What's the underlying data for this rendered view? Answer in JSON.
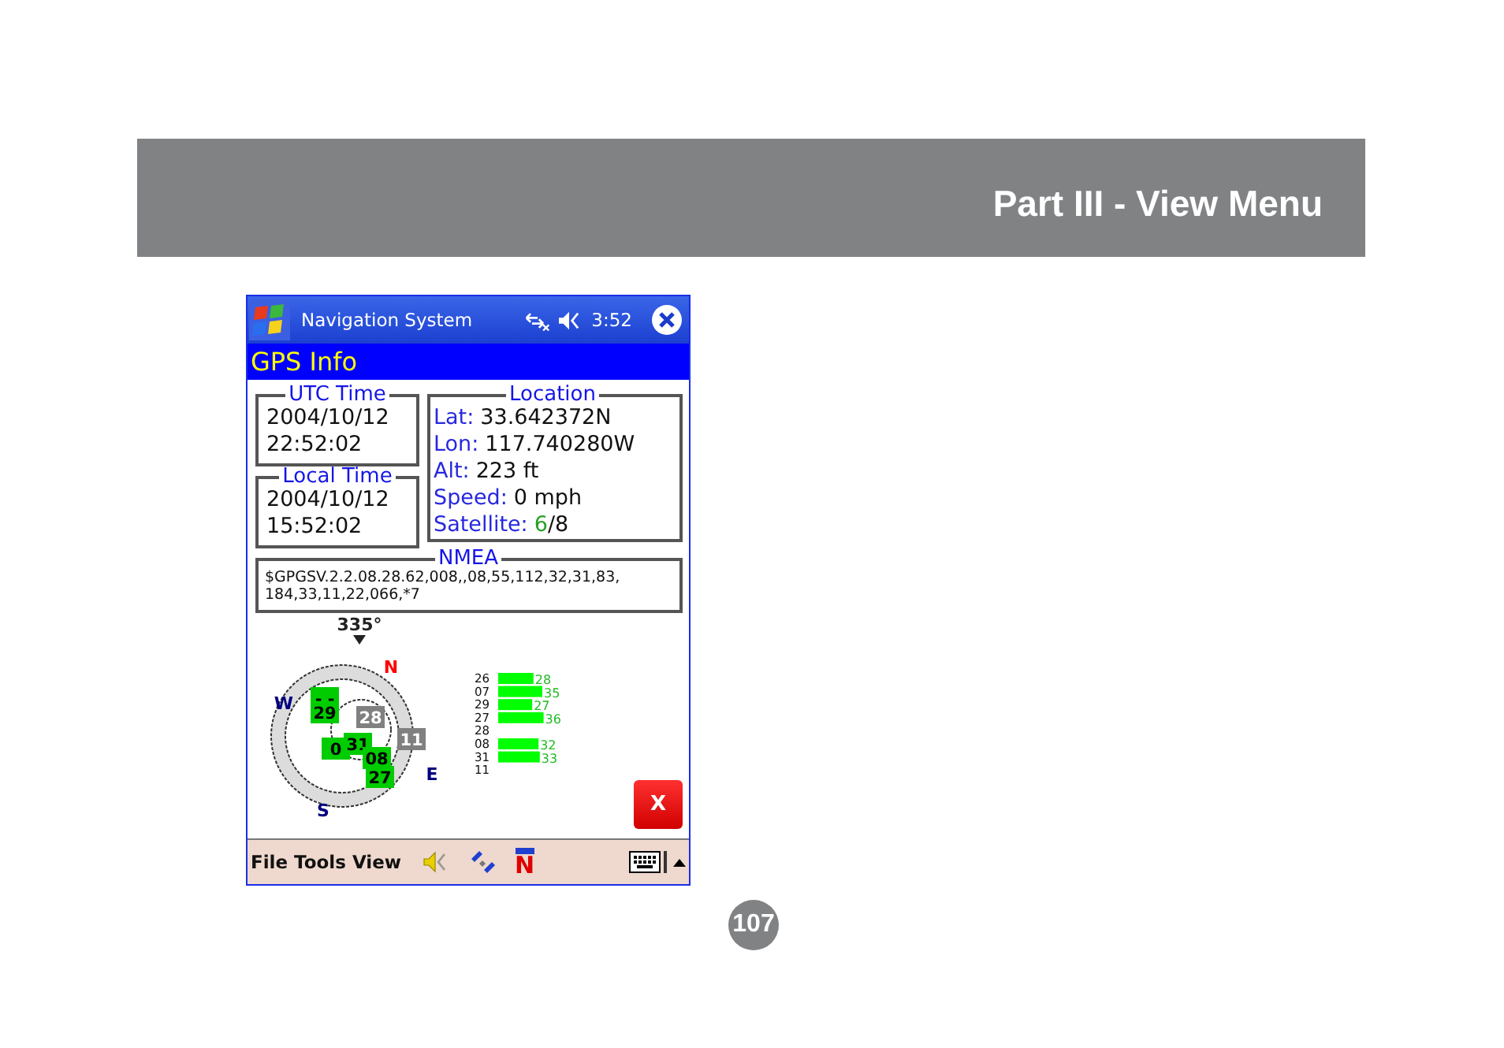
{
  "header": {
    "title": "Part III - View Menu"
  },
  "device": {
    "title_bar": {
      "app": "Navigation System",
      "time": "3:52"
    },
    "page_title": "GPS Info",
    "utc_time": {
      "label": "UTC Time",
      "date": "2004/10/12",
      "time": "22:52:02"
    },
    "local_time": {
      "label": "Local Time",
      "date": "2004/10/12",
      "time": "15:52:02"
    },
    "location": {
      "label": "Location",
      "rows": [
        {
          "label": "Lat:",
          "value": "33.642372N"
        },
        {
          "label": "Lon:",
          "value": "117.740280W"
        },
        {
          "label": "Alt:",
          "value": "223 ft"
        },
        {
          "label": "Speed:",
          "value": "0 mph"
        },
        {
          "label": "Satellite:",
          "value": "6",
          "rest": "/8"
        }
      ]
    },
    "nmea": {
      "label": "NMEA",
      "lines": [
        "$GPGSV.2.2.08.28.62,008,,08,55,112,32,31,83,",
        "184,33,11,22,066,*7"
      ]
    },
    "sky_plot": {
      "heading": "335°",
      "compass": [
        {
          "label": "N",
          "color": "#ff0000"
        },
        {
          "label": "W",
          "color": "#000080"
        },
        {
          "label": "E",
          "color": "#000080"
        },
        {
          "label": "S",
          "color": "#000080"
        }
      ],
      "satellites": [
        {
          "label": "- -",
          "tracked": true
        },
        {
          "label": "29",
          "tracked": true
        },
        {
          "label": "28",
          "tracked": false
        },
        {
          "label": "0",
          "tracked": true
        },
        {
          "label": "31",
          "tracked": true
        },
        {
          "label": "08",
          "tracked": true
        },
        {
          "label": "27",
          "tracked": true
        },
        {
          "label": "11",
          "tracked": false
        }
      ]
    },
    "signal_chart": {
      "chart_data": {
        "type": "bar",
        "orientation": "horizontal",
        "categories": [
          "26",
          "07",
          "29",
          "27",
          "28",
          "08",
          "31",
          "11"
        ],
        "series": [
          {
            "color": "#00ff00",
            "values": [
              28,
              35,
              27,
              36,
              null,
              32,
              33,
              null
            ]
          }
        ],
        "data_labels": true
      }
    },
    "close_button": "X",
    "menu_bar": {
      "items": [
        "File",
        "Tools",
        "View"
      ],
      "tools": [
        {
          "kind": "speaker"
        },
        {
          "kind": "satellite"
        },
        {
          "kind": "north",
          "label": "N"
        }
      ]
    }
  },
  "page_number": "107"
}
